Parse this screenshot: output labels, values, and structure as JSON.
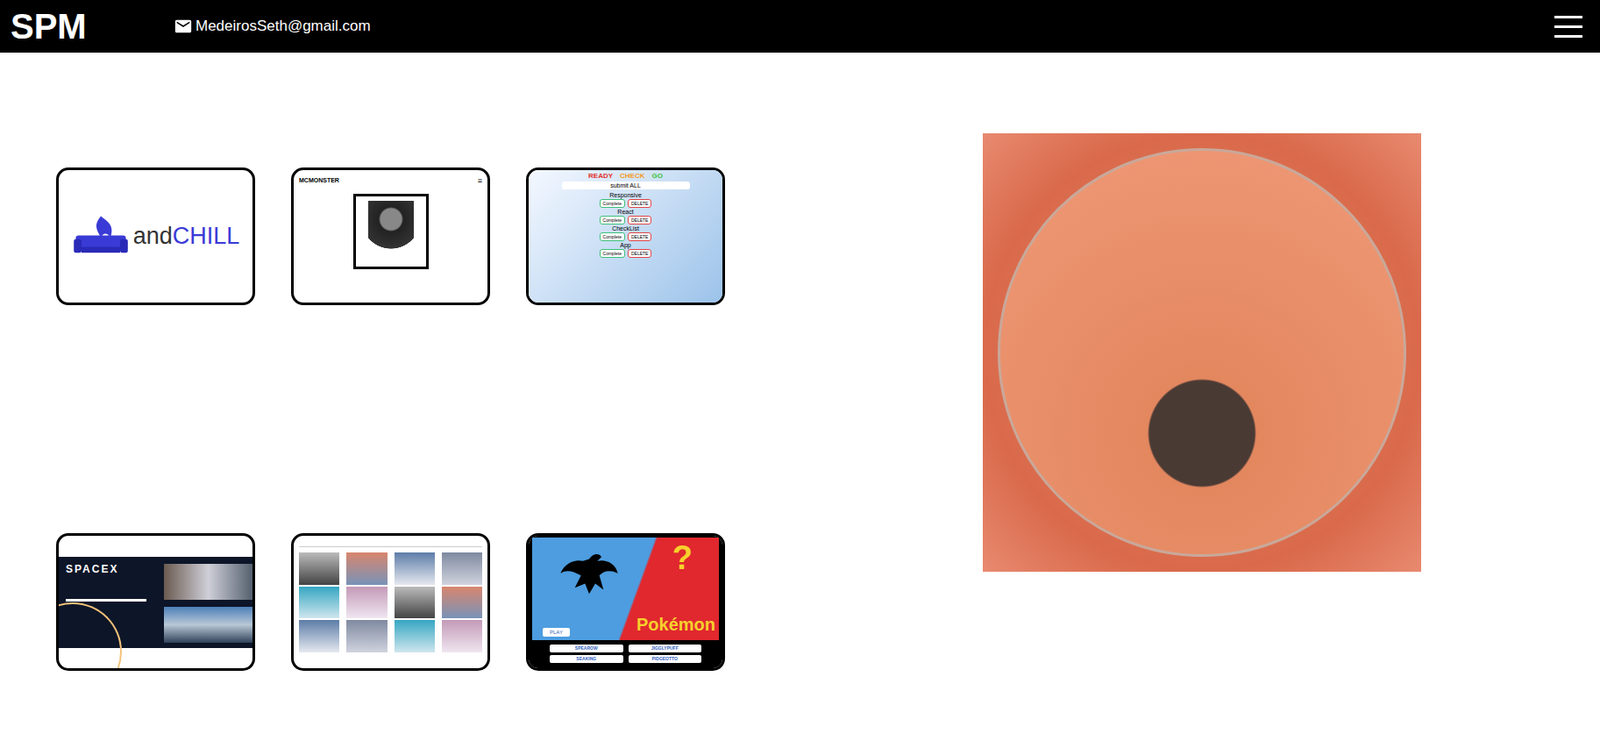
{
  "header": {
    "logo": "SPM",
    "email": "MedeirosSeth@gmail.com"
  },
  "projects": [
    {
      "kind": "logo",
      "text": "and",
      "highlight": "CHILL"
    },
    {
      "kind": "profile",
      "brand": "MCMONSTER",
      "menu": "≡"
    },
    {
      "kind": "checklist",
      "heading": [
        {
          "word": "READY",
          "color": "#e0322b"
        },
        {
          "word": "CHECK",
          "color": "#f29a1f"
        },
        {
          "word": "GO",
          "color": "#3fc23f"
        }
      ],
      "button": "submit ALL",
      "tasks": [
        {
          "name": "Responsive",
          "actions": [
            "Complete",
            "DELETE"
          ]
        },
        {
          "name": "React",
          "actions": [
            "Complete",
            "DELETE"
          ]
        },
        {
          "name": "CheckList",
          "actions": [
            "Complete",
            "DELETE"
          ]
        },
        {
          "name": "App",
          "actions": [
            "Complete",
            "DELETE"
          ]
        }
      ]
    },
    {
      "kind": "spacex",
      "brand": "SPACEX"
    },
    {
      "kind": "gallery"
    },
    {
      "kind": "quiz",
      "play": "PLAY",
      "mark": "?",
      "logo": "Pokémon",
      "choices": [
        "SPEAROW",
        "JIGGLYPUFF",
        "SEAKING",
        "PIDGEOTTO"
      ]
    }
  ]
}
